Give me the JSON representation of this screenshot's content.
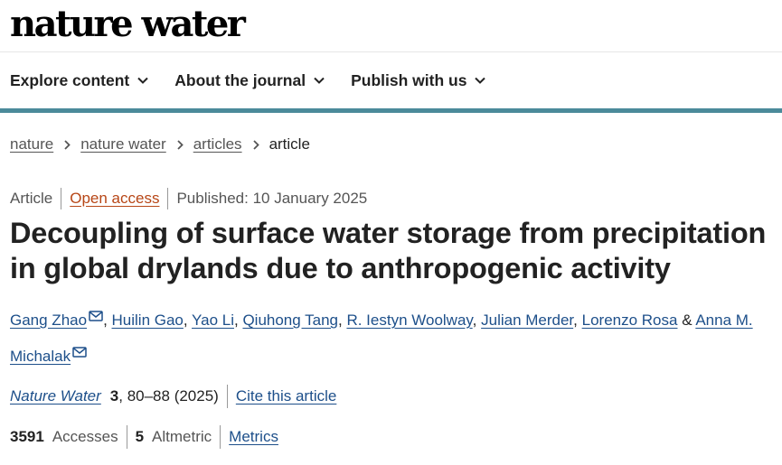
{
  "header": {
    "logo_text": "nature water"
  },
  "nav": {
    "items": [
      {
        "label": "Explore content"
      },
      {
        "label": "About the journal"
      },
      {
        "label": "Publish with us"
      }
    ]
  },
  "breadcrumb": {
    "items": [
      {
        "label": "nature"
      },
      {
        "label": "nature water"
      },
      {
        "label": "articles"
      }
    ],
    "current": "article"
  },
  "article": {
    "type": "Article",
    "access": "Open access",
    "published": "Published: 10 January 2025",
    "title": "Decoupling of surface water storage from precipitation in global drylands due to anthropogenic activity",
    "authors": [
      {
        "name": "Gang Zhao",
        "sep": ", "
      },
      {
        "name": "Huilin Gao",
        "sep": ", "
      },
      {
        "name": "Yao Li",
        "sep": ", "
      },
      {
        "name": "Qiuhong Tang",
        "sep": ", "
      },
      {
        "name": "R. Iestyn Woolway",
        "sep": ", "
      },
      {
        "name": "Julian Merder",
        "sep": ", "
      },
      {
        "name": "Lorenzo Rosa",
        "sep": " & "
      },
      {
        "name": "Anna M. Michalak",
        "sep": ""
      }
    ]
  },
  "citation": {
    "journal": "Nature Water",
    "volume": "3",
    "pages": ", 80–88 (2025)",
    "cite_link": "Cite this article"
  },
  "metrics": {
    "accesses_value": "3591",
    "accesses_label": "Accesses",
    "altmetric_value": "5",
    "altmetric_label": "Altmetric",
    "metrics_link": "Metrics"
  },
  "colors": {
    "accent_bar": "#4b8a9a",
    "link": "#1d4f8a",
    "open_access": "#b74616"
  }
}
